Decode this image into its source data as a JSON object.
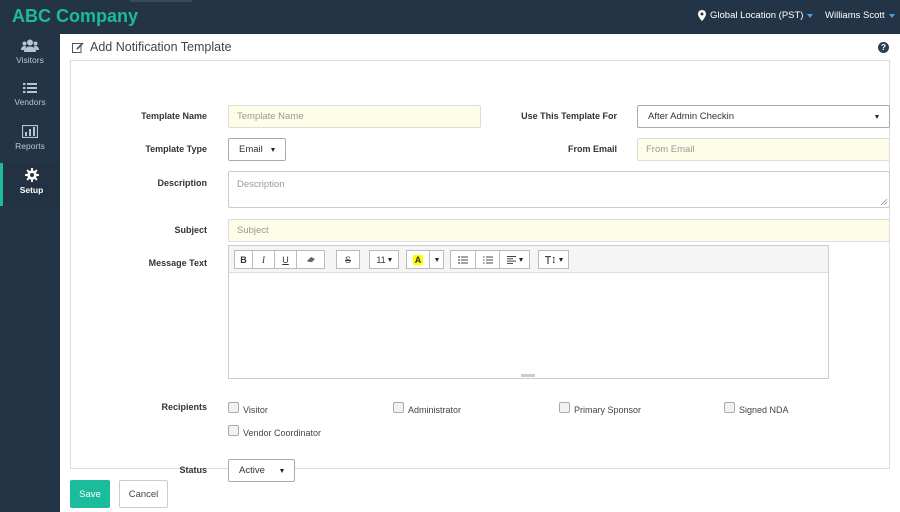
{
  "app": {
    "brand": "ABC Company"
  },
  "header": {
    "location": "Global Location (PST)",
    "user": "Williams Scott"
  },
  "sidebar": {
    "items": [
      {
        "label": "Visitors",
        "icon": "users-icon"
      },
      {
        "label": "Vendors",
        "icon": "list-icon"
      },
      {
        "label": "Reports",
        "icon": "bar-chart-icon"
      },
      {
        "label": "Setup",
        "icon": "gear-icon",
        "active": true
      }
    ]
  },
  "page": {
    "title": "Add Notification Template",
    "help": "?"
  },
  "form": {
    "template_name": {
      "label": "Template Name",
      "placeholder": "Template Name",
      "value": ""
    },
    "use_for": {
      "label": "Use This Template For",
      "value": "After Admin Checkin"
    },
    "template_type": {
      "label": "Template Type",
      "value": "Email"
    },
    "from_email": {
      "label": "From Email",
      "placeholder": "From Email",
      "value": ""
    },
    "description": {
      "label": "Description",
      "placeholder": "Description",
      "value": ""
    },
    "subject": {
      "label": "Subject",
      "placeholder": "Subject",
      "value": ""
    },
    "message": {
      "label": "Message Text",
      "font_size": "11",
      "highlight_letter": "A"
    },
    "recipients": {
      "label": "Recipients",
      "options": [
        "Visitor",
        "Administrator",
        "Primary Sponsor",
        "Signed NDA",
        "Vendor Coordinator"
      ]
    },
    "status": {
      "label": "Status",
      "value": "Active"
    }
  },
  "actions": {
    "save": "Save",
    "cancel": "Cancel"
  },
  "colors": {
    "accent": "#1abc9c",
    "nav_bg": "#243447",
    "link_caret": "#4aa3df",
    "highlight": "#ffff00"
  }
}
